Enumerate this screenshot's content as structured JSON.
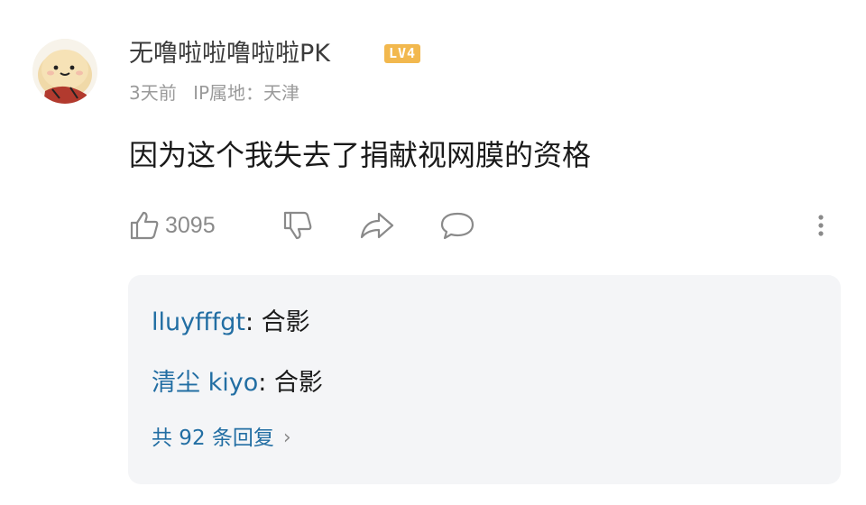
{
  "comment": {
    "username": "无噜啦啦噜啦啦PK",
    "level": "LV4",
    "time": "3天前",
    "ip_label": "IP属地：天津",
    "text": "因为这个我失去了捐献视网膜的资格"
  },
  "actions": {
    "like_count": "3095",
    "icons": [
      "thumbs-up-icon",
      "thumbs-down-icon",
      "share-icon",
      "comment-icon",
      "more-icon"
    ]
  },
  "replies": {
    "items": [
      {
        "name": "lluyfffgt",
        "text": ": 合影"
      },
      {
        "name": "清尘 kiyo",
        "text": ": 合影"
      }
    ],
    "more_label": "共 92 条回复",
    "chevron": "›"
  },
  "colors": {
    "link": "#226ea3",
    "badge": "#f2b84e",
    "meta": "#9a9a9a",
    "reply_bg": "#f4f5f7"
  }
}
